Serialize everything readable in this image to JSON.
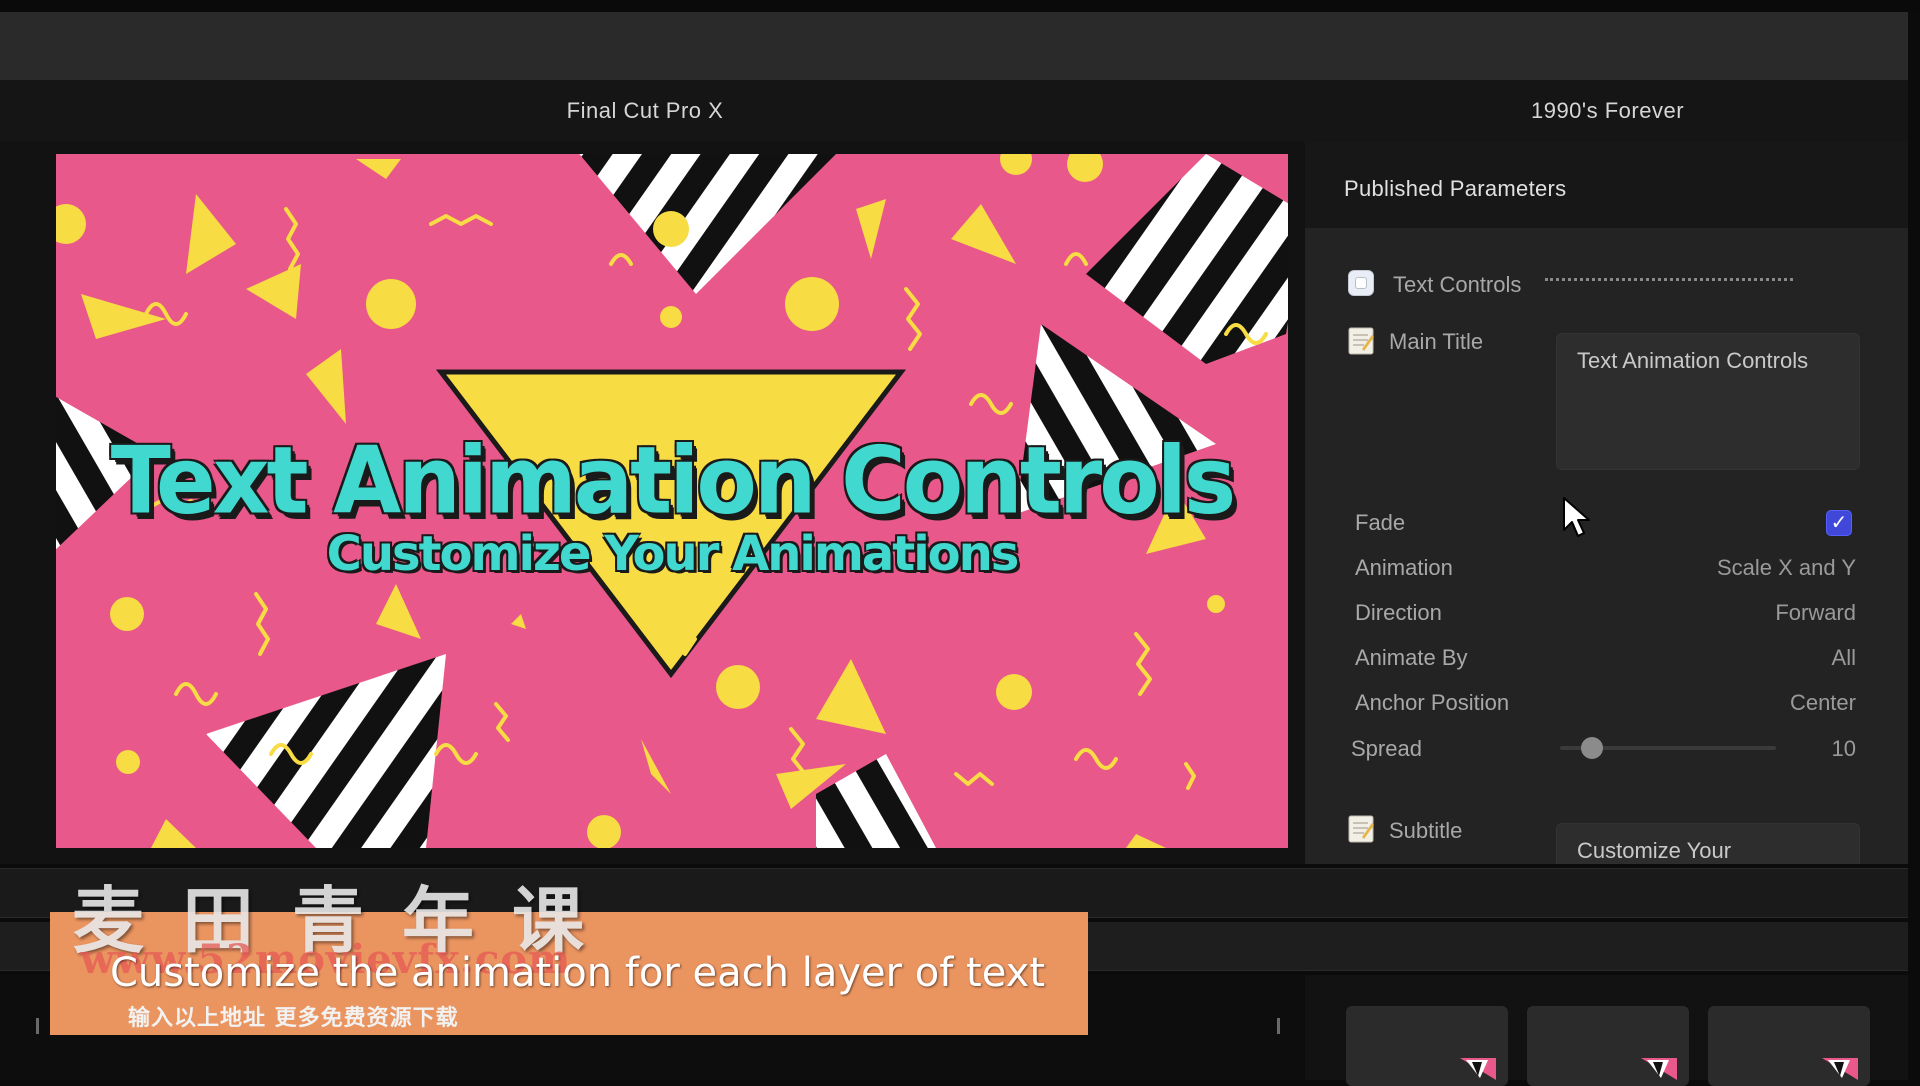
{
  "header": {
    "app_title": "Final Cut Pro X",
    "project_title": "1990's Forever"
  },
  "viewer": {
    "main_title": "Text Animation Controls",
    "subtitle": "Customize Your Animations",
    "background_color": "#e8588a",
    "shape_color": "#f7dc43",
    "text_color": "#41d9cf"
  },
  "inspector": {
    "heading": "Published Parameters",
    "text_controls_label": "Text Controls",
    "main_title": {
      "label": "Main Title",
      "value": "Text Animation Controls"
    },
    "params": [
      {
        "label": "Fade",
        "type": "checkbox",
        "checked": true
      },
      {
        "label": "Animation",
        "value": "Scale X and Y"
      },
      {
        "label": "Direction",
        "value": "Forward"
      },
      {
        "label": "Animate By",
        "value": "All"
      },
      {
        "label": "Anchor Position",
        "value": "Center"
      }
    ],
    "spread": {
      "label": "Spread",
      "value": "10"
    },
    "subtitle": {
      "label": "Subtitle",
      "value": "Customize Your"
    }
  },
  "overlay": {
    "caption": "Customize the animation for each layer of text",
    "watermark_cn": "麦田青年课",
    "watermark_url": "www.52movievfx.com",
    "watermark_hint": "输入以上地址 更多免费资源下载"
  }
}
